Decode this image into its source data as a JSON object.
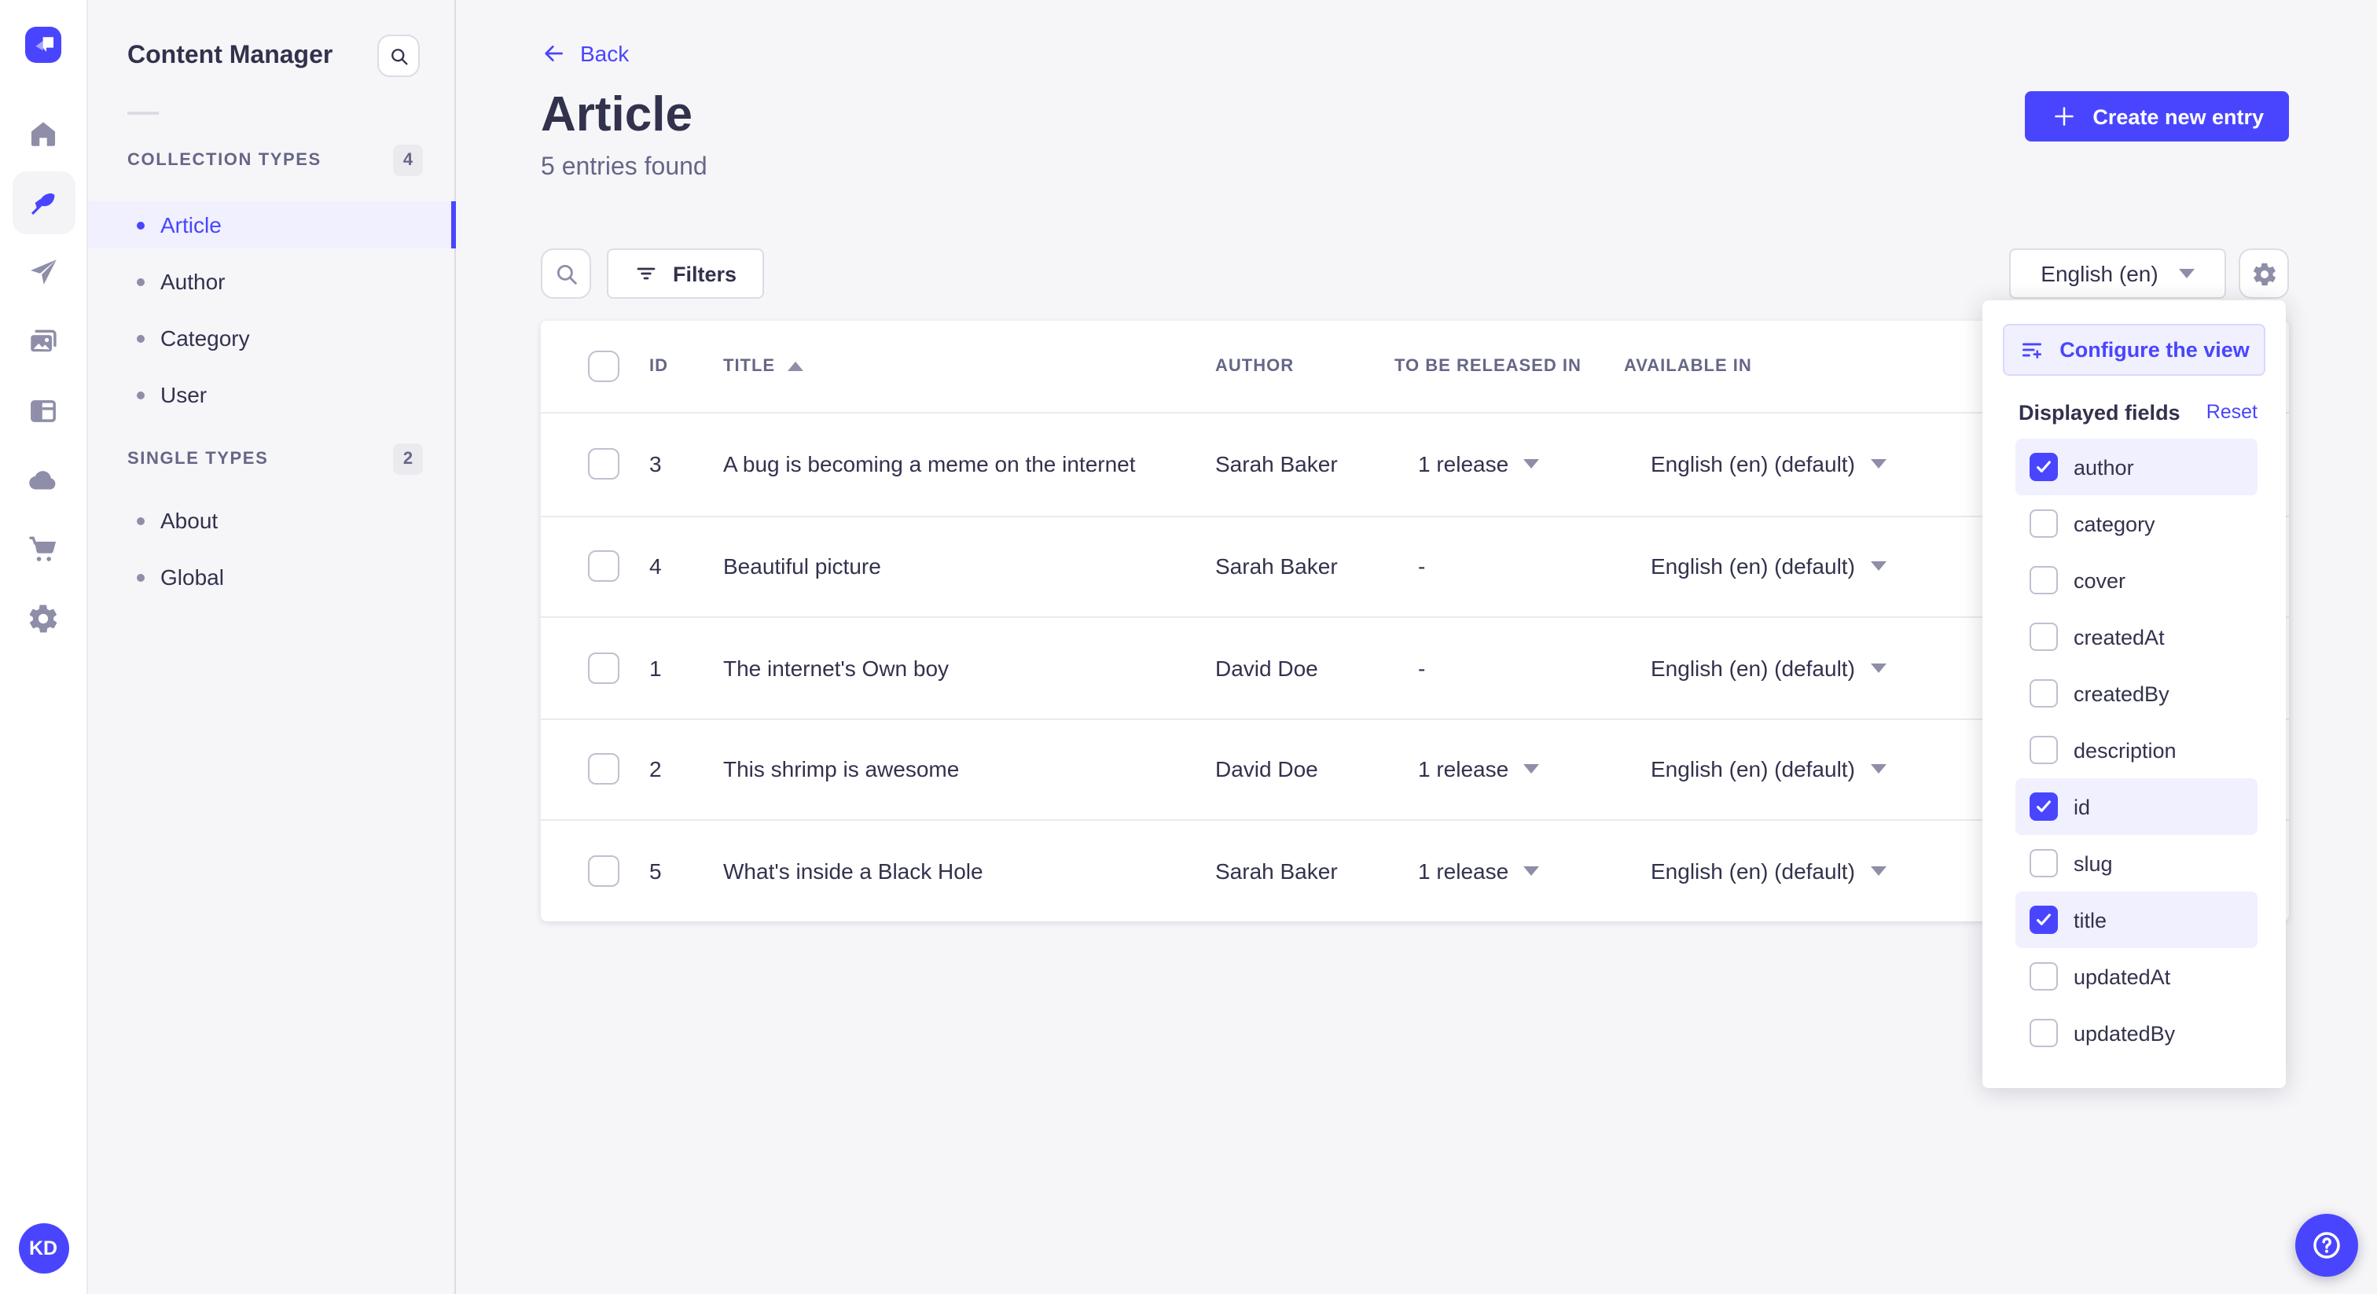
{
  "app": {
    "window_title": "Content Manager"
  },
  "colors": {
    "accent": "#4945ff",
    "accent_light_bg": "#f0f0ff",
    "text_dark": "#32324d",
    "text_muted": "#666687",
    "icon_muted": "#8e8ea9",
    "border": "#dcdce4",
    "page_bg": "#f6f6f9"
  },
  "rail": {
    "avatar_initials": "KD"
  },
  "subnav": {
    "title": "Content Manager",
    "sections": [
      {
        "label": "COLLECTION TYPES",
        "badge": "4",
        "items": [
          {
            "label": "Article",
            "active": true
          },
          {
            "label": "Author",
            "active": false
          },
          {
            "label": "Category",
            "active": false
          },
          {
            "label": "User",
            "active": false
          }
        ]
      },
      {
        "label": "SINGLE TYPES",
        "badge": "2",
        "items": [
          {
            "label": "About",
            "active": false
          },
          {
            "label": "Global",
            "active": false
          }
        ]
      }
    ]
  },
  "header": {
    "back_label": "Back",
    "title": "Article",
    "subtitle": "5 entries found",
    "create_label": "Create new entry"
  },
  "toolbar": {
    "filters_label": "Filters",
    "locale_value": "English (en)"
  },
  "table": {
    "headers": {
      "id": "ID",
      "title": "TITLE",
      "author": "AUTHOR",
      "released": "TO BE RELEASED IN",
      "available": "AVAILABLE IN"
    },
    "rows": [
      {
        "id": "3",
        "title": "A bug is becoming a meme on the internet",
        "author": "Sarah Baker",
        "released": "1 release",
        "released_caret": true,
        "available": "English (en) (default)"
      },
      {
        "id": "4",
        "title": "Beautiful picture",
        "author": "Sarah Baker",
        "released": "-",
        "released_caret": false,
        "available": "English (en) (default)"
      },
      {
        "id": "1",
        "title": "The internet's Own boy",
        "author": "David Doe",
        "released": "-",
        "released_caret": false,
        "available": "English (en) (default)"
      },
      {
        "id": "2",
        "title": "This shrimp is awesome",
        "author": "David Doe",
        "released": "1 release",
        "released_caret": true,
        "available": "English (en) (default)"
      },
      {
        "id": "5",
        "title": "What's inside a Black Hole",
        "author": "Sarah Baker",
        "released": "1 release",
        "released_caret": true,
        "available": "English (en) (default)"
      }
    ]
  },
  "popover": {
    "configure_label": "Configure the view",
    "section_title": "Displayed fields",
    "reset_label": "Reset",
    "fields": [
      {
        "label": "author",
        "checked": true
      },
      {
        "label": "category",
        "checked": false
      },
      {
        "label": "cover",
        "checked": false
      },
      {
        "label": "createdAt",
        "checked": false
      },
      {
        "label": "createdBy",
        "checked": false
      },
      {
        "label": "description",
        "checked": false
      },
      {
        "label": "id",
        "checked": true
      },
      {
        "label": "slug",
        "checked": false
      },
      {
        "label": "title",
        "checked": true
      },
      {
        "label": "updatedAt",
        "checked": false
      },
      {
        "label": "updatedBy",
        "checked": false
      }
    ]
  }
}
